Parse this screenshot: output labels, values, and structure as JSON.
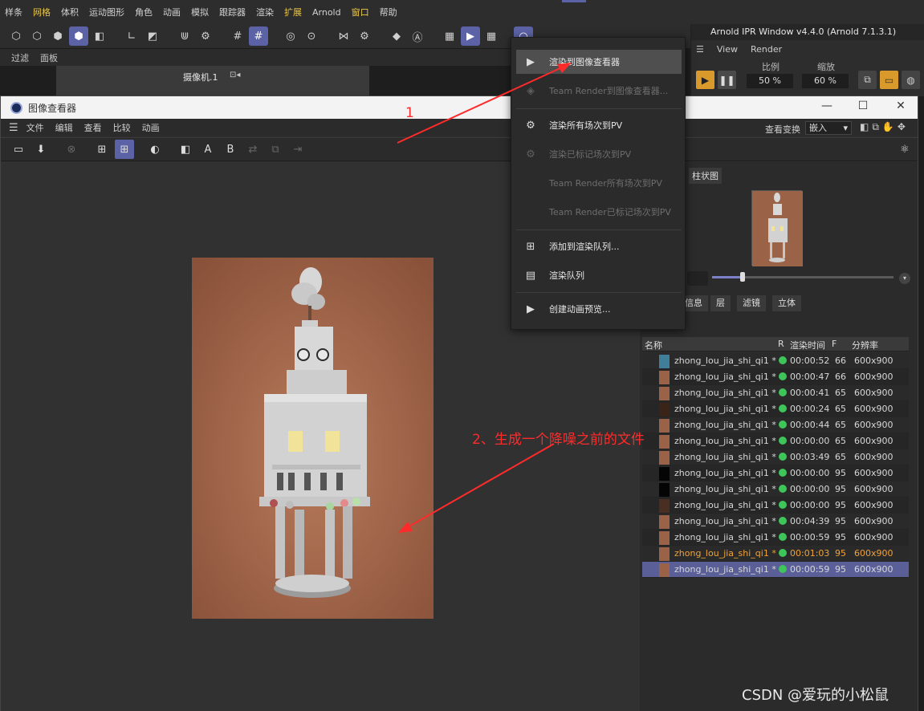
{
  "menubar": {
    "items": [
      "样条",
      "网格",
      "体积",
      "运动图形",
      "角色",
      "动画",
      "模拟",
      "跟踪器",
      "渲染",
      "扩展",
      "Arnold",
      "窗口",
      "帮助"
    ],
    "highlighted": [
      "网格",
      "扩展",
      "窗口"
    ]
  },
  "subbar": {
    "items": [
      "过滤",
      "面板"
    ]
  },
  "viewport": {
    "camera_label": "摄像机.1"
  },
  "viewer": {
    "title": "图像查看器",
    "menu": [
      "文件",
      "编辑",
      "查看",
      "比较",
      "动画"
    ],
    "view_switch_label": "查看变换",
    "embed_value": "嵌入",
    "compare_a": "A",
    "compare_b": "B",
    "histogram_tab": "柱状图",
    "panel_tabs": [
      "信息",
      "层",
      "滤镜",
      "立体"
    ],
    "table": {
      "headers": [
        "名称",
        "R",
        "渲染时间",
        "F",
        "分辨率"
      ],
      "rows": [
        {
          "name": "zhong_lou_jia_shi_qi1 *",
          "time": "00:00:52",
          "f": "66",
          "res": "600x900",
          "thumb": "#3f7f9a"
        },
        {
          "name": "zhong_lou_jia_shi_qi1 *",
          "time": "00:00:47",
          "f": "66",
          "res": "600x900",
          "thumb": "#9a6247"
        },
        {
          "name": "zhong_lou_jia_shi_qi1 *",
          "time": "00:00:41",
          "f": "65",
          "res": "600x900",
          "thumb": "#9a6247"
        },
        {
          "name": "zhong_lou_jia_shi_qi1 *",
          "time": "00:00:24",
          "f": "65",
          "res": "600x900",
          "thumb": "#3a2418"
        },
        {
          "name": "zhong_lou_jia_shi_qi1 *",
          "time": "00:00:44",
          "f": "65",
          "res": "600x900",
          "thumb": "#9a6247"
        },
        {
          "name": "zhong_lou_jia_shi_qi1 *",
          "time": "00:00:00",
          "f": "65",
          "res": "600x900",
          "thumb": "#9a6247"
        },
        {
          "name": "zhong_lou_jia_shi_qi1 *",
          "time": "00:03:49",
          "f": "65",
          "res": "600x900",
          "thumb": "#9a6247"
        },
        {
          "name": "zhong_lou_jia_shi_qi1 *",
          "time": "00:00:00",
          "f": "95",
          "res": "600x900",
          "thumb": "#050505"
        },
        {
          "name": "zhong_lou_jia_shi_qi1 *",
          "time": "00:00:00",
          "f": "95",
          "res": "600x900",
          "thumb": "#050505"
        },
        {
          "name": "zhong_lou_jia_shi_qi1 *",
          "time": "00:00:00",
          "f": "95",
          "res": "600x900",
          "thumb": "#4a2e22"
        },
        {
          "name": "zhong_lou_jia_shi_qi1 *",
          "time": "00:04:39",
          "f": "95",
          "res": "600x900",
          "thumb": "#9a6247"
        },
        {
          "name": "zhong_lou_jia_shi_qi1 *",
          "time": "00:00:59",
          "f": "95",
          "res": "600x900",
          "thumb": "#9a6247"
        },
        {
          "name": "zhong_lou_jia_shi_qi1 *",
          "time": "00:01:03",
          "f": "95",
          "res": "600x900",
          "thumb": "#9a6247"
        },
        {
          "name": "zhong_lou_jia_shi_qi1 *",
          "time": "00:00:59",
          "f": "95",
          "res": "600x900",
          "thumb": "#9a6247"
        }
      ]
    }
  },
  "arnold_ipr": {
    "title": "Arnold IPR Window v4.4.0 (Arnold 7.1.3.1)",
    "menu": [
      "View",
      "Render"
    ],
    "ratio_label": "比例",
    "ratio_value": "50 %",
    "zoom_label": "缩放",
    "zoom_value": "60 %"
  },
  "popup": {
    "items": [
      {
        "label": "渲染到图像查看器",
        "enabled": true,
        "highlighted": true
      },
      {
        "label": "Team Render到图像查看器...",
        "enabled": false
      },
      {
        "label": "渲染所有场次到PV",
        "enabled": true
      },
      {
        "label": "渲染已标记场次到PV",
        "enabled": false
      },
      {
        "label": "Team Render所有场次到PV",
        "enabled": false
      },
      {
        "label": "Team Render已标记场次到PV",
        "enabled": false
      },
      {
        "label": "添加到渲染队列...",
        "enabled": true
      },
      {
        "label": "渲染队列",
        "enabled": true
      },
      {
        "label": "创建动画预览...",
        "enabled": true
      }
    ]
  },
  "annotations": {
    "step1": "1",
    "step2": "2、生成一个降噪之前的文件"
  },
  "watermark": "CSDN @爱玩的小松鼠",
  "colors": {
    "accent": "#5c62a6",
    "annotation": "#ff2b2b",
    "active_row": "#f0a23a",
    "status_green": "#3ec55a"
  }
}
